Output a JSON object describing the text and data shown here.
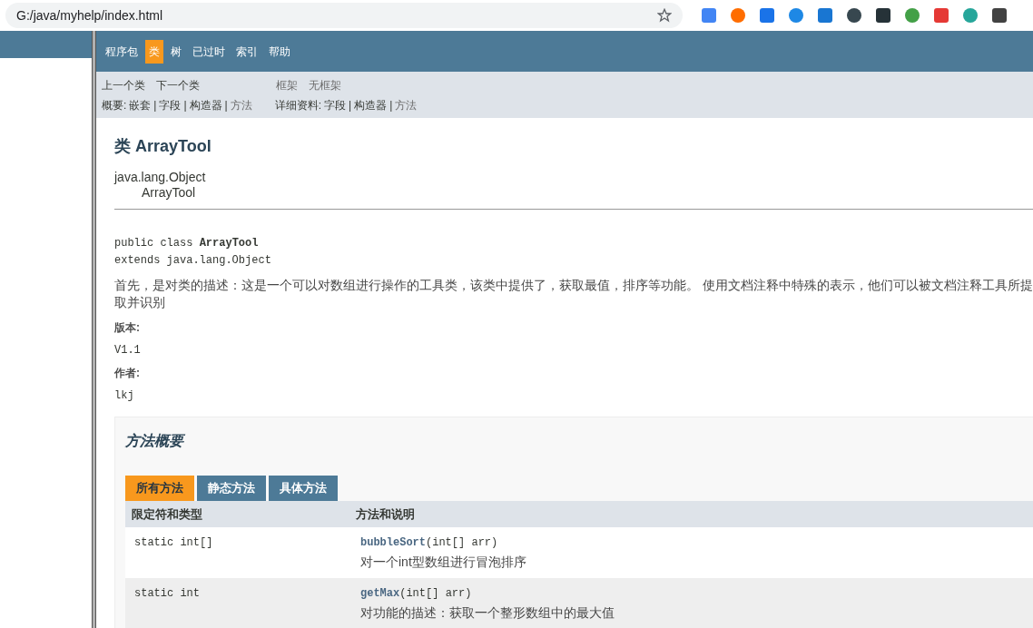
{
  "address_bar": {
    "url": "G:/java/myhelp/index.html"
  },
  "navbar": {
    "items": [
      {
        "label": "程序包",
        "selected": false
      },
      {
        "label": "类",
        "selected": true
      },
      {
        "label": "树",
        "selected": false
      },
      {
        "label": "已过时",
        "selected": false
      },
      {
        "label": "索引",
        "selected": false
      },
      {
        "label": "帮助",
        "selected": false
      }
    ]
  },
  "subnav": {
    "row1": [
      {
        "label": "上一个类",
        "disabled": false
      },
      {
        "label": "下一个类",
        "disabled": false
      },
      {
        "label": "框架",
        "disabled": true
      },
      {
        "label": "无框架",
        "disabled": true
      }
    ],
    "separator": "|",
    "summary_label": "概要:",
    "summary": [
      {
        "label": "嵌套",
        "disabled": false
      },
      {
        "label": "字段",
        "disabled": false
      },
      {
        "label": "构造器",
        "disabled": false
      },
      {
        "label": "方法",
        "disabled": true
      }
    ],
    "detail_label": "详细资料:",
    "detail": [
      {
        "label": "字段",
        "disabled": false
      },
      {
        "label": "构造器",
        "disabled": false
      },
      {
        "label": "方法",
        "disabled": true
      }
    ]
  },
  "class_title": "类 ArrayTool",
  "inheritance": [
    "java.lang.Object",
    "ArrayTool"
  ],
  "signature": {
    "line1": "public class **ArrayTool**",
    "line2": "extends java.lang.Object"
  },
  "description": [
    "首先，是对类的描述：这是一个可以对数组进行操作的工具类，该类中提供了，获取最值，排序等功能。 使用文档注释中特殊的表示，他们可以被文档注释工具所提",
    "取并识别"
  ],
  "tags": [
    {
      "label": "版本:",
      "value": "V1.1"
    },
    {
      "label": "作者:",
      "value": "lkj"
    }
  ],
  "method_summary": {
    "title": "方法概要",
    "tabs": [
      {
        "label": "所有方法",
        "selected": true
      },
      {
        "label": "静态方法",
        "selected": false
      },
      {
        "label": "具体方法",
        "selected": false
      }
    ],
    "columns": [
      "限定符和类型",
      "方法和说明"
    ],
    "rows": [
      {
        "type": "static int[]",
        "method": "**bubbleSort**(int[]  arr)",
        "description": "对一个int型数组进行冒泡排序"
      },
      {
        "type": "static int",
        "method": "**getMax**(int[]  arr)",
        "description": "对功能的描述：获取一个整形数组中的最大值"
      }
    ]
  }
}
